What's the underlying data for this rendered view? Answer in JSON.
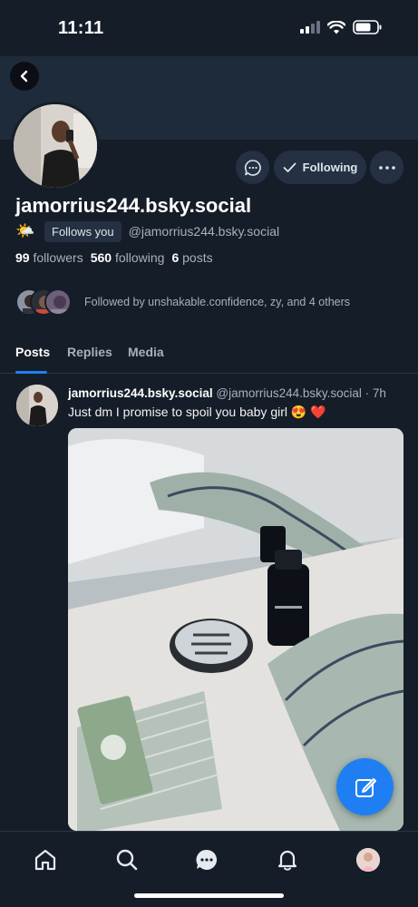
{
  "status_bar": {
    "time": "11:11"
  },
  "profile": {
    "display_name": "jamorrius244.bsky.social",
    "emoji": "🌤️",
    "follows_you": "Follows you",
    "handle": "@jamorrius244.bsky.social",
    "followers_count": "99",
    "followers_label": "followers",
    "following_count": "560",
    "following_label": "following",
    "posts_count": "6",
    "posts_label": "posts",
    "followed_by": "Followed by unshakable.confidence, zy, and 4 others",
    "following_button": "Following"
  },
  "tabs": [
    "Posts",
    "Replies",
    "Media"
  ],
  "post": {
    "author_name": "jamorrius244.bsky.social",
    "author_handle": "@jamorrius244.bsky.social",
    "separator": " · ",
    "time": "7h",
    "text": "Just dm I promise to spoil you baby girl 😍 ❤️"
  },
  "colors": {
    "accent": "#1f7ff2",
    "background": "#151d28",
    "banner": "#1e2b3a"
  },
  "icons": [
    "back-arrow-icon",
    "message-icon",
    "check-icon",
    "more-icon",
    "compose-icon",
    "home-icon",
    "search-icon",
    "chat-icon",
    "bell-icon"
  ]
}
